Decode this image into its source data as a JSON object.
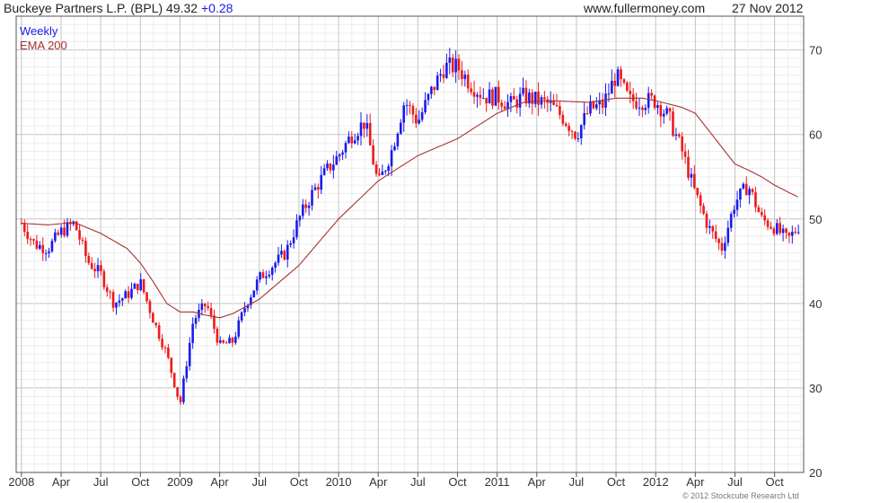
{
  "header": {
    "title": "Buckeye Partners L.P. (BPL) 49.32",
    "change": "+0.28",
    "site": "www.fullermoney.com",
    "date": "27 Nov 2012"
  },
  "colors": {
    "up": "#1a1aee",
    "down": "#ee1a1a",
    "ema": "#a83232",
    "grid": "#dcdcdc",
    "frame": "#555555"
  },
  "copyright": "© 2012 Stockcube Research Ltd",
  "chart_data": {
    "type": "line",
    "title": "Buckeye Partners L.P. (BPL) 49.32 +0.28",
    "legend": [
      "Weekly",
      "EMA 200"
    ],
    "legend_position": "top-left",
    "grid": true,
    "ylim": [
      20,
      74
    ],
    "y_ticks": [
      20,
      30,
      40,
      50,
      60,
      70
    ],
    "x_tick_labels": [
      "2008",
      "Apr",
      "Jul",
      "Oct",
      "2009",
      "Apr",
      "Jul",
      "Oct",
      "2010",
      "Apr",
      "Jul",
      "Oct",
      "2011",
      "Apr",
      "Jul",
      "Oct",
      "2012",
      "Apr",
      "Jul",
      "Oct"
    ],
    "x_tick_months": [
      0,
      3,
      6,
      9,
      12,
      15,
      18,
      21,
      24,
      27,
      30,
      33,
      36,
      39,
      42,
      45,
      48,
      51,
      54,
      57
    ],
    "x_range_months": [
      -0.4,
      59.2
    ],
    "series": [
      {
        "name": "Weekly",
        "representation": "weekly price bars (blue = up week, red = down week)",
        "months": [
          0,
          1,
          2,
          3,
          4,
          5,
          6,
          7,
          8,
          9,
          10,
          11,
          12,
          13,
          14,
          15,
          16,
          17,
          18,
          19,
          20,
          21,
          22,
          23,
          24,
          25,
          26,
          27,
          28,
          29,
          30,
          31,
          32,
          33,
          34,
          35,
          36,
          37,
          38,
          39,
          40,
          41,
          42,
          43,
          44,
          45,
          46,
          47,
          48,
          49,
          50,
          51,
          52,
          53,
          54,
          55,
          56,
          57,
          58,
          58.9
        ],
        "values": [
          49.5,
          47,
          46.5,
          48.5,
          49.5,
          45,
          43.5,
          40,
          41,
          42.5,
          38,
          34,
          28,
          38,
          40,
          35,
          35.5,
          40,
          43,
          44.5,
          46,
          50,
          53,
          55.5,
          57.5,
          60,
          61.5,
          54,
          58,
          64,
          61.5,
          65,
          68,
          68,
          66,
          64.5,
          64.5,
          63.5,
          64.5,
          64,
          63.5,
          62,
          60,
          63,
          63.5,
          67,
          64,
          64,
          64,
          62,
          58,
          53,
          49,
          46.5,
          52,
          54,
          50,
          49,
          47.5,
          49.32
        ]
      },
      {
        "name": "EMA 200",
        "months": [
          0,
          2,
          4,
          6,
          8,
          9,
          10,
          11,
          12,
          13,
          14,
          15,
          16,
          18,
          21,
          24,
          27,
          30,
          33,
          36,
          38,
          40,
          43,
          45,
          47,
          48,
          49,
          50,
          51,
          52,
          53,
          54,
          55,
          56,
          57,
          58,
          58.9
        ],
        "values": [
          49.5,
          49.3,
          49.6,
          48.3,
          46.5,
          44.8,
          42.5,
          40,
          39,
          39,
          38.6,
          38.3,
          38.8,
          40.5,
          44.5,
          50,
          54.5,
          57.5,
          59.5,
          62.5,
          63.8,
          64,
          63.8,
          64.3,
          64.3,
          64,
          63.6,
          63.2,
          62.5,
          60.5,
          58.5,
          56.5,
          55.8,
          55,
          54,
          53.2,
          52.5
        ]
      }
    ]
  }
}
